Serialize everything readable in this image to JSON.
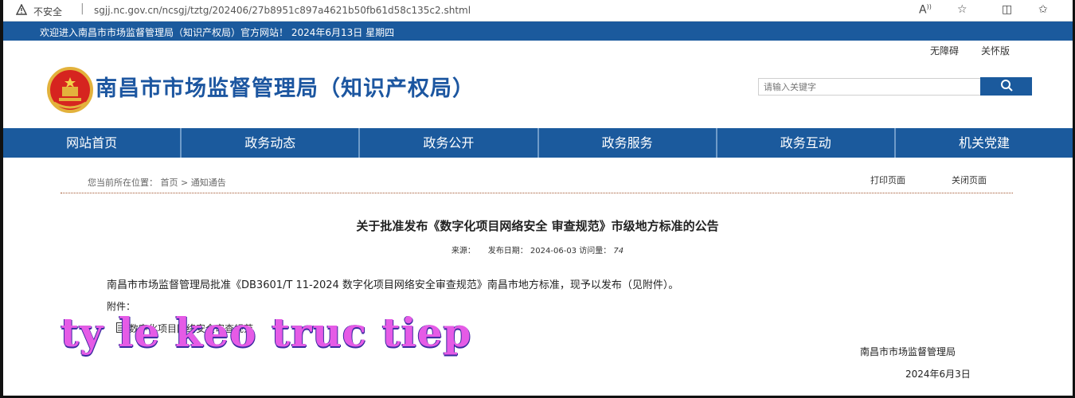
{
  "browser": {
    "insecure_label": "不安全",
    "separator": "|",
    "url": "sgjj.nc.gov.cn/ncsgj/tztg/202406/27b8951c897a4621b50fb61d58c135c2.shtml"
  },
  "topbar": {
    "welcome": "欢迎进入南昌市市场监督管理局（知识产权局）官方网站！ 2024年6月13日 星期四"
  },
  "header": {
    "accessibility_link": "无障碍",
    "care_link": "关怀版",
    "site_title": "南昌市市场监督管理局（知识产权局）",
    "search_placeholder": "请输入关键字"
  },
  "nav": {
    "items": [
      "网站首页",
      "政务动态",
      "政务公开",
      "政务服务",
      "政务互动",
      "机关党建"
    ]
  },
  "breadcrumb": {
    "prefix": "您当前所在位置：",
    "home": "首页",
    "separator": ">",
    "current": "通知通告"
  },
  "tools": {
    "print": "打印页面",
    "close": "关闭页面"
  },
  "article": {
    "title": "关于批准发布《数字化项目网络安全 审查规范》市级地方标准的公告",
    "source_label": "来源：",
    "date_label": "发布日期：",
    "date": "2024-06-03",
    "views_label": "访问量：",
    "views": "74",
    "body": "南昌市市场监督管理局批准《DB3601/T 11-2024 数字化项目网络安全审查规范》南昌市地方标准，现予以发布（见附件）。",
    "attachment_label": "附件：",
    "attachment_text": "数字化项目网络安全审查规范",
    "overlay_text": "ty le keo truc tiep",
    "signature_org": "南昌市市场监督管理局",
    "signature_date": "2024年6月3日"
  },
  "colors": {
    "brand_blue": "#1b5a9d",
    "title_blue": "#1c56a0",
    "overlay_magenta": "#e55be6"
  },
  "icons": [
    "warning-icon",
    "read-aloud-icon",
    "favorite-star-icon",
    "split-screen-icon",
    "favorites-list-icon",
    "emblem-icon",
    "search-icon",
    "document-icon"
  ]
}
